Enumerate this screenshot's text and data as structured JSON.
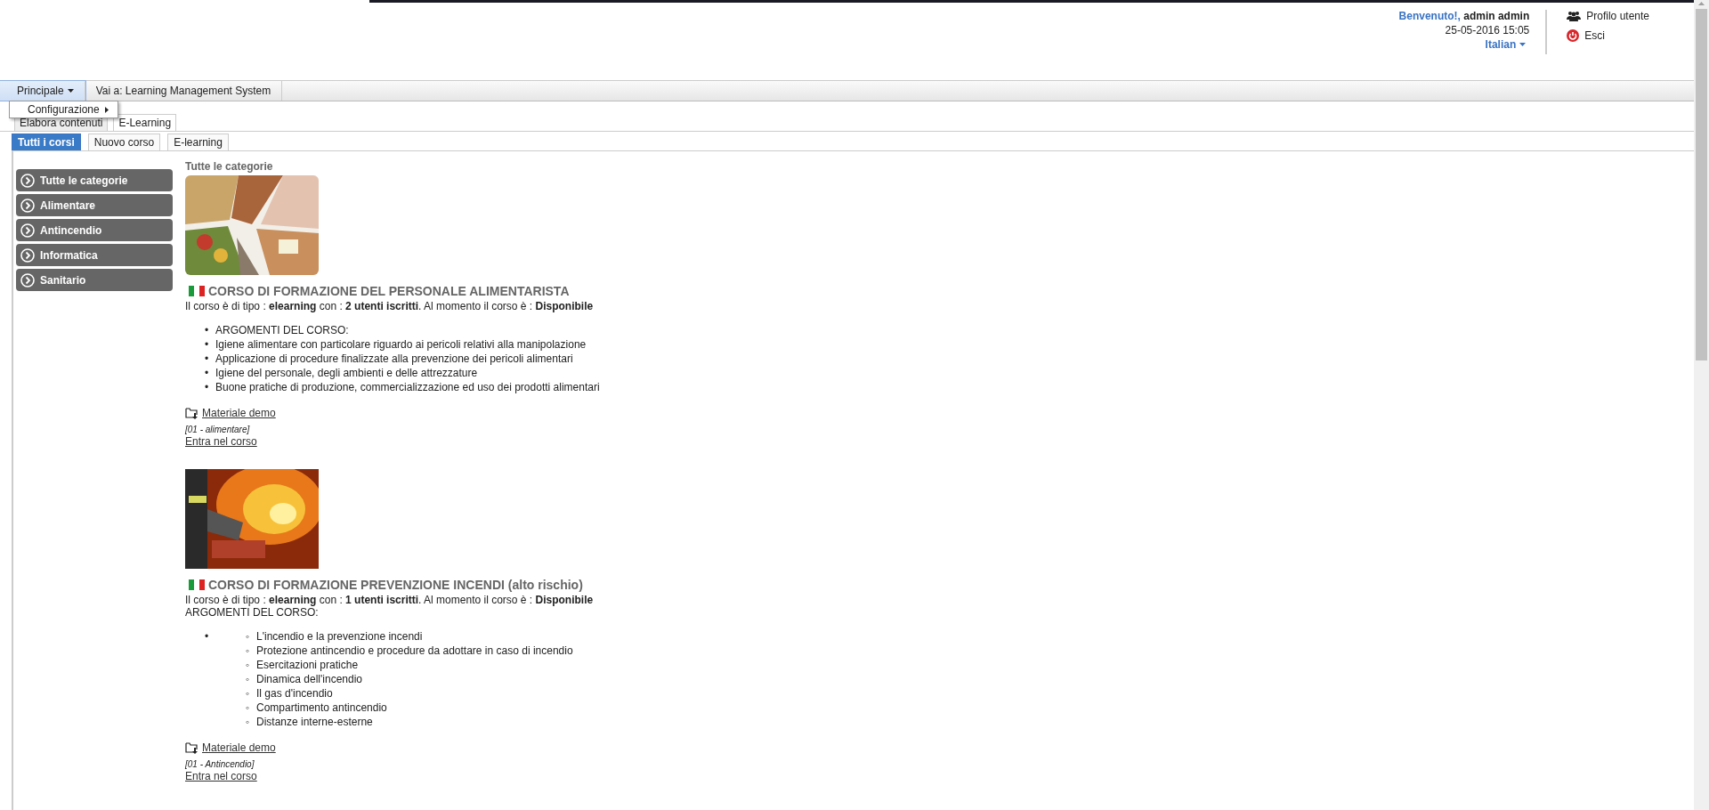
{
  "header": {
    "welcome": "Benvenuto!,",
    "user": "admin admin",
    "datetime": "25-05-2016 15:05",
    "language": "Italian",
    "links": [
      {
        "kind": "profile",
        "label": "Profilo utente"
      },
      {
        "kind": "logout",
        "label": "Esci"
      }
    ]
  },
  "menubar": {
    "items": [
      {
        "label": "Principale",
        "dropdown": true,
        "selected": true
      },
      {
        "label": "Vai a: Learning Management System",
        "dropdown": false,
        "selected": false
      }
    ],
    "open_menu": {
      "items": [
        {
          "label": "Configurazione",
          "submenu": true
        }
      ]
    }
  },
  "section_tabs": [
    {
      "label": "Elabora contenuti",
      "selected": false
    },
    {
      "label": "E-Learning",
      "selected": true
    }
  ],
  "tabs": [
    {
      "label": "Tutti i corsi",
      "selected": true
    },
    {
      "label": "Nuovo corso",
      "selected": false
    },
    {
      "label": "E-learning",
      "selected": false
    }
  ],
  "sidebar": {
    "items": [
      {
        "label": "Tutte le categorie"
      },
      {
        "label": "Alimentare"
      },
      {
        "label": "Antincendio"
      },
      {
        "label": "Informatica"
      },
      {
        "label": "Sanitario"
      }
    ]
  },
  "content": {
    "heading": "Tutte le categorie",
    "courses": [
      {
        "image": {
          "kind": "food"
        },
        "title": "CORSO DI FORMAZIONE DEL PERSONALE ALIMENTARISTA",
        "info": "Il corso è di tipo : **elearning** con : **2 utenti iscritti**. Al momento il corso è : **Disponibile**",
        "topics": [
          {
            "marker": "•",
            "text": "ARGOMENTI DEL CORSO:"
          },
          {
            "marker": "•",
            "text": "Igiene alimentare con particolare riguardo ai pericoli relativi alla manipolazione"
          },
          {
            "marker": "•",
            "text": "Applicazione di procedure finalizzate alla prevenzione dei pericoli alimentari"
          },
          {
            "marker": "•",
            "text": "Igiene del personale, degli ambienti e delle attrezzature"
          },
          {
            "marker": "•",
            "text": "Buone pratiche di produzione, commercializzazione ed uso dei prodotti alimentari"
          }
        ],
        "material": "Materiale demo",
        "code": "[01 - alimentare]",
        "enter": "Entra nel corso"
      },
      {
        "image": {
          "kind": "fire"
        },
        "title": "CORSO DI FORMAZIONE PREVENZIONE INCENDI (alto rischio)",
        "info": "Il corso è di tipo : **elearning** con : **1 utenti iscritti**. Al momento il corso è : **Disponibile**",
        "intro": "ARGOMENTI DEL CORSO:",
        "topics": [
          {
            "marker": "•",
            "children": [
              {
                "marker": "◦",
                "text": "L'incendio e la prevenzione incendi"
              },
              {
                "marker": "◦",
                "text": "Protezione antincendio e procedure da adottare in caso di incendio"
              },
              {
                "marker": "◦",
                "text": "Esercitazioni pratiche"
              },
              {
                "marker": "◦",
                "text": "Dinamica dell'incendio"
              },
              {
                "marker": "◦",
                "text": "Il gas d'incendio"
              },
              {
                "marker": "◦",
                "text": "Compartimento antincendio"
              },
              {
                "marker": "◦",
                "text": "Distanze interne-esterne"
              }
            ]
          }
        ],
        "material": "Materiale demo",
        "code": "[01 - Antincendio]",
        "enter": "Entra nel corso"
      }
    ]
  }
}
